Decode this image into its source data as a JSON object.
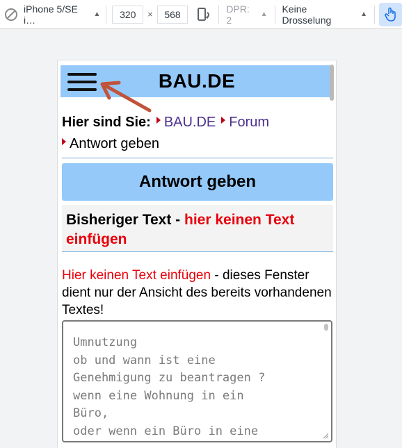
{
  "devtools": {
    "device": "iPhone 5/SE i…",
    "width": "320",
    "times": "×",
    "height": "568",
    "dpr": "DPR: 2",
    "throttle": "Keine Drosselung",
    "accent_color": "#d2e3fc"
  },
  "page": {
    "site_title": "BAU.DE",
    "breadcrumb": {
      "label": "Hier sind Sie:",
      "items": [
        "BAU.DE",
        "Forum",
        "Antwort geben"
      ]
    },
    "reply_heading": "Antwort geben",
    "previous_text_heading": {
      "prefix": "Bisheriger Text - ",
      "warning": "hier keinen Text einfügen"
    },
    "info": {
      "warning": "Hier keinen Text einfügen",
      "rest": " - dieses Fenster dient nur der Ansicht des bereits vorhandenen Textes!"
    },
    "previous_text": "Umnutzung\nob und wann ist eine\nGenehmigung zu beantragen ?\nwenn eine Wohnung in ein\nBüro,\noder wenn ein Büro in eine",
    "colors": {
      "header_bg": "#94c9fa",
      "warning": "#e8000b",
      "link": "#4b2f8f",
      "arrow": "#c0533a"
    }
  }
}
